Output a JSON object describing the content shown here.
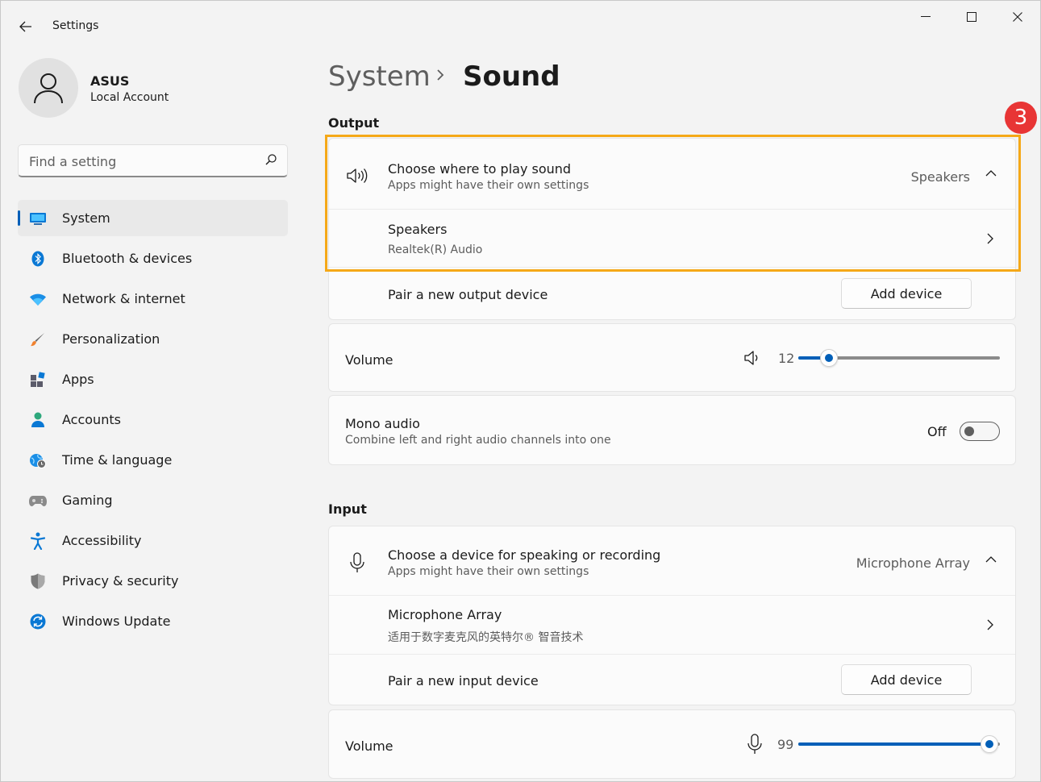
{
  "window": {
    "title": "Settings"
  },
  "profile": {
    "name": "ASUS",
    "account_type": "Local Account"
  },
  "search": {
    "placeholder": "Find a setting"
  },
  "nav": {
    "items": [
      {
        "label": "System",
        "icon": "system-icon",
        "active": true
      },
      {
        "label": "Bluetooth & devices",
        "icon": "bluetooth-icon"
      },
      {
        "label": "Network & internet",
        "icon": "wifi-icon"
      },
      {
        "label": "Personalization",
        "icon": "brush-icon"
      },
      {
        "label": "Apps",
        "icon": "apps-icon"
      },
      {
        "label": "Accounts",
        "icon": "accounts-icon"
      },
      {
        "label": "Time & language",
        "icon": "globe-clock-icon"
      },
      {
        "label": "Gaming",
        "icon": "gamepad-icon"
      },
      {
        "label": "Accessibility",
        "icon": "accessibility-icon"
      },
      {
        "label": "Privacy & security",
        "icon": "shield-icon"
      },
      {
        "label": "Windows Update",
        "icon": "update-icon"
      }
    ]
  },
  "breadcrumb": {
    "parent": "System",
    "current": "Sound"
  },
  "annotation": {
    "step": "3",
    "color": "#f5a818"
  },
  "output": {
    "section_title": "Output",
    "choose": {
      "title": "Choose where to play sound",
      "subtitle": "Apps might have their own settings",
      "value": "Speakers"
    },
    "device": {
      "name": "Speakers",
      "driver": "Realtek(R) Audio"
    },
    "pair": {
      "label": "Pair a new output device",
      "button": "Add device"
    },
    "volume": {
      "label": "Volume",
      "value": "12",
      "level": 12
    },
    "mono": {
      "title": "Mono audio",
      "subtitle": "Combine left and right audio channels into one",
      "state": "Off"
    }
  },
  "input": {
    "section_title": "Input",
    "choose": {
      "title": "Choose a device for speaking or recording",
      "subtitle": "Apps might have their own settings",
      "value": "Microphone Array"
    },
    "device": {
      "name": "Microphone Array",
      "driver": "适用于数字麦克风的英特尔® 智音技术"
    },
    "pair": {
      "label": "Pair a new input device",
      "button": "Add device"
    },
    "volume": {
      "label": "Volume",
      "value": "99",
      "level": 99
    }
  },
  "colors": {
    "accent": "#005fb8",
    "background": "#f3f3f3",
    "card": "#fbfbfb"
  }
}
